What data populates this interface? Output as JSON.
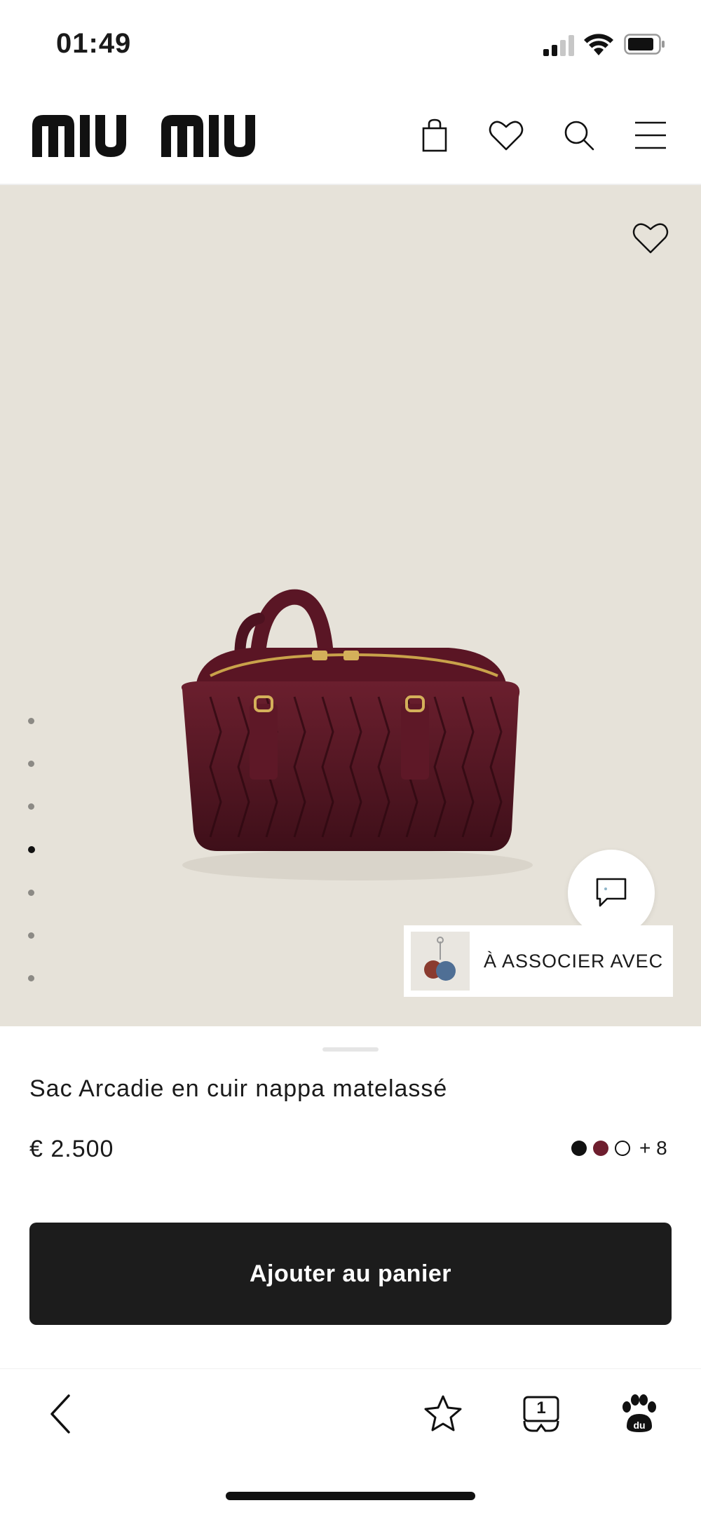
{
  "status_bar": {
    "time": "01:49",
    "icons": [
      "signal-icon",
      "wifi-icon",
      "battery-icon"
    ]
  },
  "header": {
    "logo_text": "miu miu",
    "icons": [
      "shopping-bag-icon",
      "heart-icon",
      "search-icon",
      "menu-icon"
    ]
  },
  "hero": {
    "image": "burgundy-quilted-handbag",
    "background_color": "#e6e2d9",
    "carousel": {
      "total": 7,
      "active_index": 3
    },
    "associate_label": "À ASSOCIER AVEC"
  },
  "product": {
    "name": "Sac Arcadie en cuir nappa matelassé",
    "price": "€ 2.500",
    "colors": [
      "#111111",
      "#6e1e2e",
      "#ffffff"
    ],
    "more_colors": "+ 8",
    "add_to_cart_label": "Ajouter au panier"
  },
  "browser_bar": {
    "tab_count": "1",
    "icons": [
      "back-arrow-icon",
      "star-icon",
      "tabs-icon",
      "baidu-paw-icon"
    ]
  }
}
